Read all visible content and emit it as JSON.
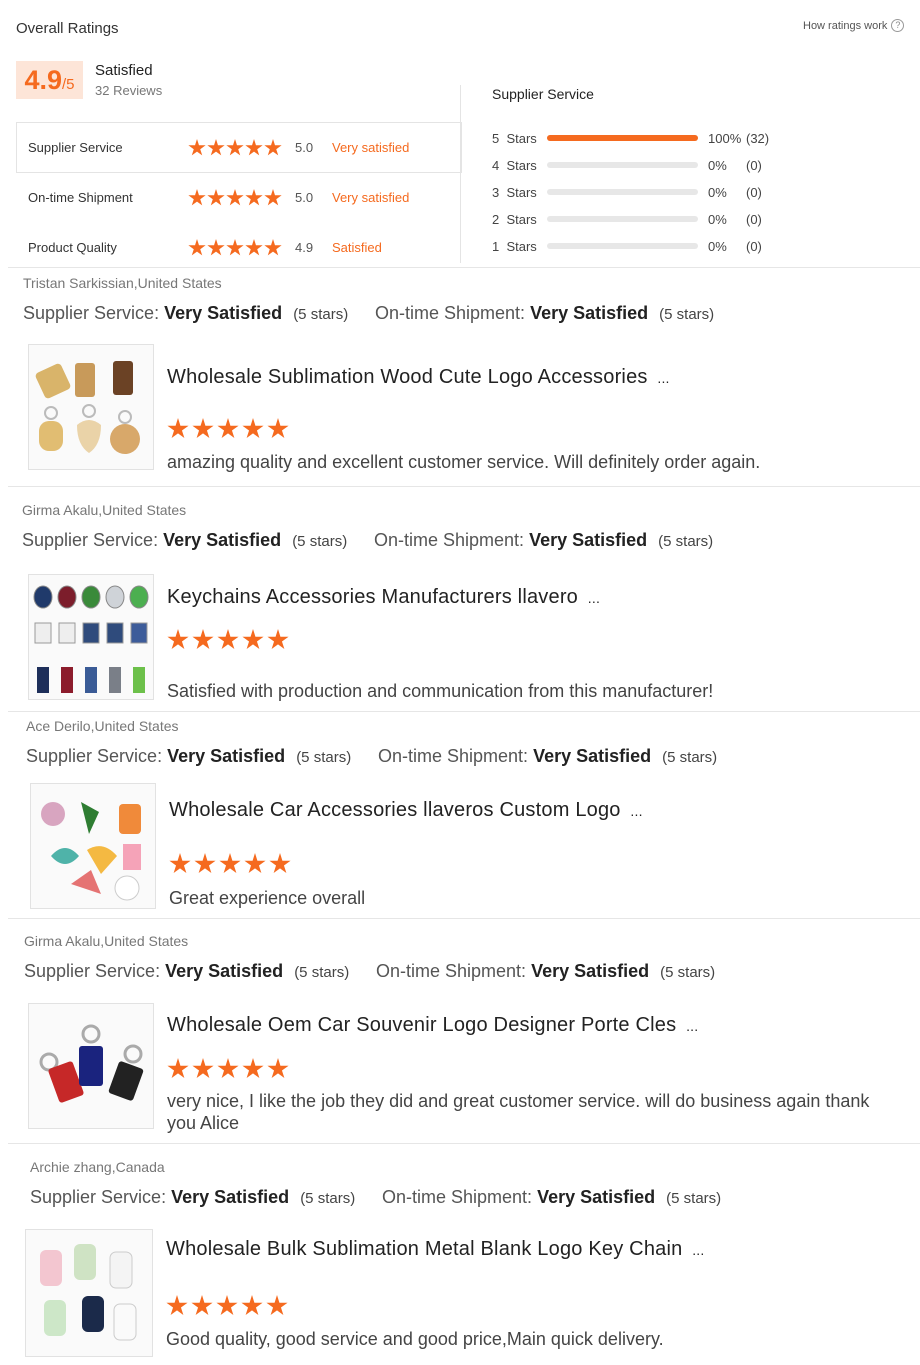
{
  "header": {
    "title": "Overall Ratings",
    "how_link": "How ratings work",
    "help_icon": "?"
  },
  "overall": {
    "score": "4.9",
    "out_of": "/5",
    "label": "Satisfied",
    "reviews": "32 Reviews"
  },
  "categories": [
    {
      "name": "Supplier Service",
      "score": "5.0",
      "label": "Very satisfied",
      "stars": 5
    },
    {
      "name": "On-time Shipment",
      "score": "5.0",
      "label": "Very satisfied",
      "stars": 5
    },
    {
      "name": "Product Quality",
      "score": "4.9",
      "label": "Satisfied",
      "stars": 5
    }
  ],
  "breakdown": {
    "title": "Supplier Service",
    "rows": [
      {
        "label": "5  Stars",
        "pct": "100%",
        "count": "(32)",
        "fill": 1.0
      },
      {
        "label": "4  Stars",
        "pct": "0%",
        "count": "(0)",
        "fill": 0
      },
      {
        "label": "3  Stars",
        "pct": "0%",
        "count": "(0)",
        "fill": 0
      },
      {
        "label": "2  Stars",
        "pct": "0%",
        "count": "(0)",
        "fill": 0
      },
      {
        "label": "1  Stars",
        "pct": "0%",
        "count": "(0)",
        "fill": 0
      }
    ]
  },
  "labels": {
    "supplier_service": "Supplier Service:",
    "ontime_shipment": "On-time Shipment:",
    "very_satisfied": "Very Satisfied",
    "five_stars": "(5 stars)"
  },
  "reviews": [
    {
      "reviewer": "Tristan Sarkissian,United States",
      "product": "Wholesale Sublimation Wood Cute Logo Accessories",
      "ellipsis": "...",
      "comment": "amazing quality and excellent customer service. Will definitely order again.",
      "stars": 5
    },
    {
      "reviewer": "Girma Akalu,United States",
      "product": "Keychains Accessories Manufacturers llavero",
      "ellipsis": "...",
      "comment": "Satisfied with production and communication from this manufacturer!",
      "stars": 5
    },
    {
      "reviewer": "Ace Derilo,United States",
      "product": "Wholesale Car Accessories llaveros Custom Logo",
      "ellipsis": "...",
      "comment": "Great experience overall",
      "stars": 5
    },
    {
      "reviewer": "Girma Akalu,United States",
      "product": "Wholesale Oem Car Souvenir Logo Designer Porte Cles",
      "ellipsis": "...",
      "comment": "very nice, I like the job they did and great customer service. will do business again thank you Alice",
      "stars": 5
    },
    {
      "reviewer": "Archie zhang,Canada",
      "product": "Wholesale Bulk Sublimation Metal Blank Logo Key Chain",
      "ellipsis": "...",
      "comment": "Good quality, good service and good price,Main quick delivery.",
      "stars": 5
    }
  ],
  "colors": {
    "accent": "#f56a1f",
    "score_bg": "#fde5d8",
    "track": "#e7e7e7"
  }
}
